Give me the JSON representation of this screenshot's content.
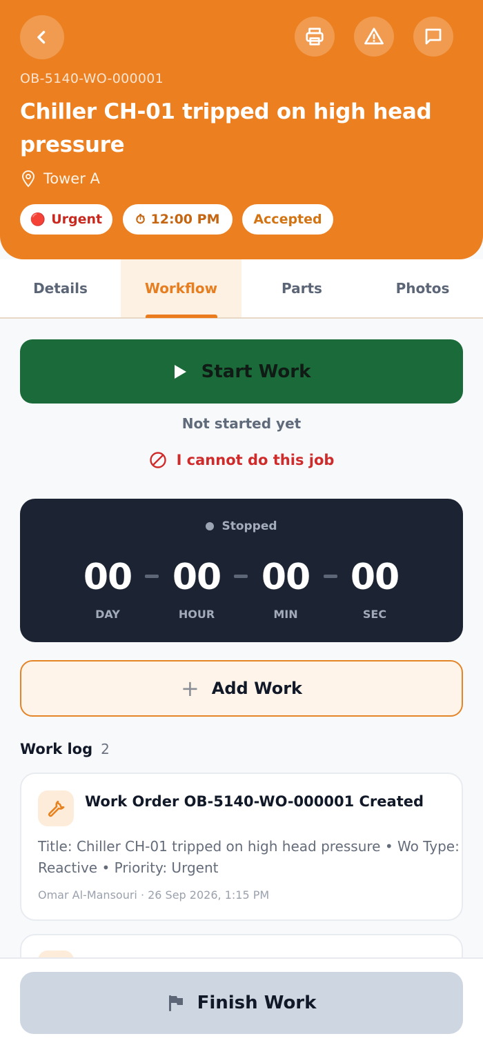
{
  "header": {
    "work_order_code": "OB-5140-WO-000001",
    "title": "Chiller CH-01 tripped on high head pressure",
    "location": "Tower A",
    "chips": {
      "priority": "Urgent",
      "priority_icon": "🔴",
      "time": "12:00 PM",
      "time_icon": "⏱",
      "status": "Accepted"
    },
    "accent_color": "#ec7f1f"
  },
  "tabs": [
    {
      "label": "Details"
    },
    {
      "label": "Workflow"
    },
    {
      "label": "Parts"
    },
    {
      "label": "Photos"
    }
  ],
  "workflow": {
    "start_label": "Start Work",
    "state_text": "Not started yet",
    "cannot_label": "I cannot do this job",
    "timer": {
      "status": "Stopped",
      "day": "00",
      "hour": "00",
      "min": "00",
      "sec": "00",
      "day_label": "DAY",
      "hour_label": "HOUR",
      "min_label": "MIN",
      "sec_label": "SEC"
    },
    "add_work_label": "Add Work"
  },
  "work_log": {
    "title": "Work log",
    "count": "2",
    "entries": [
      {
        "icon": "wrench-icon",
        "title": "Work Order OB-5140-WO-000001 Created",
        "description": "Title: Chiller CH-01 tripped on high head pressure • Wo Type: Reactive • Priority: Urgent",
        "meta": "Omar Al-Mansouri · 26 Sep 2026, 1:15 PM"
      }
    ]
  },
  "footer": {
    "finish_label": "Finish Work"
  },
  "colors": {
    "start_button": "#1b6b3a",
    "timer_bg": "#1c2433",
    "danger": "#cf2b2b",
    "finish_button": "#cdd6e1"
  }
}
